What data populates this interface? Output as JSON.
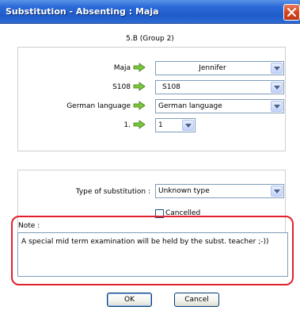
{
  "window": {
    "title": "Substitution - Absenting : Maja"
  },
  "group_label": "5.B (Group 2)",
  "rows": [
    {
      "label": "Maja",
      "value": "Jennifer"
    },
    {
      "label": "S108",
      "value": "S108"
    },
    {
      "label": "German language",
      "value": "German language"
    },
    {
      "label": "1.",
      "value": "1"
    }
  ],
  "substitution": {
    "type_label": "Type of substitution :",
    "type_value": "Unknown type",
    "cancelled_label": "Cancelled",
    "cancelled_checked": false
  },
  "note": {
    "label": "Note :",
    "text": "A special mid term examination will be held by the subst. teacher ;-))"
  },
  "buttons": {
    "ok": "OK",
    "cancel": "Cancel"
  },
  "colors": {
    "titlebar": "#2a69d8",
    "close_button": "#d2421c",
    "highlight": "#e0202a",
    "arrow": "#7cc83a"
  },
  "icons": {
    "close": "close-icon",
    "arrow": "green-arrow-right-icon",
    "dropdown": "chevron-down-icon"
  }
}
